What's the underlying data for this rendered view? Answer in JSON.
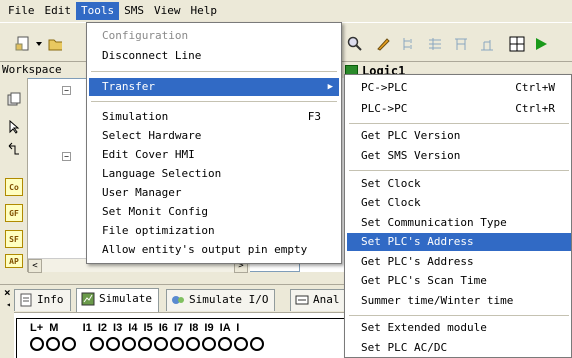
{
  "menubar": {
    "items": [
      "File",
      "Edit",
      "Tools",
      "SMS",
      "View",
      "Help"
    ]
  },
  "workspace": {
    "title": "Workspace"
  },
  "logic_tab": {
    "label": "Logic1"
  },
  "toolbar": {
    "left_icons": [
      "new-file-icon",
      "dropdown-arrow-icon",
      "open-folder-icon"
    ],
    "right_icons": [
      "zoom-icon",
      "pencil-icon",
      "tool-a-icon",
      "tool-b-icon",
      "tool-c-icon",
      "tool-d-icon",
      "grid-icon",
      "run-icon"
    ]
  },
  "side_tools": {
    "tags": [
      "Co",
      "GF",
      "SF",
      "AP"
    ]
  },
  "tools_menu": {
    "items": [
      {
        "label": "Configuration",
        "disabled": true
      },
      {
        "label": "Disconnect Line"
      },
      {
        "label": "Transfer",
        "submenu": true,
        "highlighted": true
      },
      {
        "label": "Simulation",
        "shortcut": "F3"
      },
      {
        "label": "Select Hardware"
      },
      {
        "label": "Edit Cover HMI"
      },
      {
        "label": "Language Selection"
      },
      {
        "label": "User Manager"
      },
      {
        "label": "Set Monit Config"
      },
      {
        "label": "File optimization"
      },
      {
        "label": "Allow entity's output pin empty"
      }
    ]
  },
  "transfer_menu": {
    "items": [
      {
        "label": "PC->PLC",
        "shortcut": "Ctrl+W"
      },
      {
        "label": "PLC->PC",
        "shortcut": "Ctrl+R"
      },
      {
        "label": "Get PLC Version"
      },
      {
        "label": "Get SMS Version"
      },
      {
        "label": "Set Clock"
      },
      {
        "label": "Get Clock"
      },
      {
        "label": "Set Communication Type"
      },
      {
        "label": "Set PLC's Address",
        "highlighted": true
      },
      {
        "label": "Get PLC's Address"
      },
      {
        "label": "Get PLC's Scan Time"
      },
      {
        "label": "Summer time/Winter time"
      },
      {
        "label": "Set Extended module"
      },
      {
        "label": "Set PLC AC/DC"
      }
    ]
  },
  "bottom_tabs": [
    {
      "label": "Info"
    },
    {
      "label": "Simulate",
      "selected": true
    },
    {
      "label": "Simulate I/O"
    },
    {
      "label": "Anal"
    }
  ],
  "plc": {
    "labels": "L+ M    I1 I2 I3 I4 I5 I6 I7 I8 I9 IA I"
  },
  "colors": {
    "highlight": "#316ac5",
    "menu_bg": "#ece9d8"
  }
}
